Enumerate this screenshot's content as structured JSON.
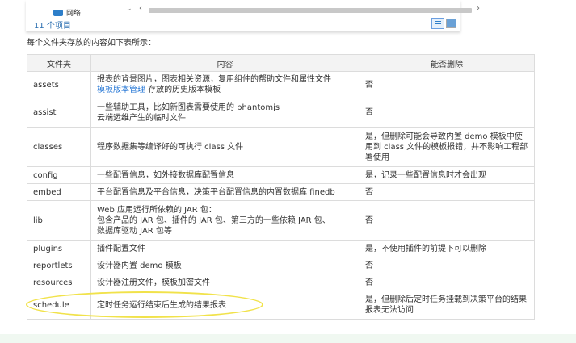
{
  "explorer": {
    "nav_item": "网络",
    "item_count": "11 个项目",
    "chevron": "⌄",
    "scroll_left": "‹",
    "scroll_right": "›"
  },
  "intro": "每个文件夹存放的内容如下表所示：",
  "table": {
    "headers": [
      "文件夹",
      "内容",
      "能否删除"
    ],
    "rows": [
      {
        "folder": "assets",
        "content_line1": "报表的背景图片，图表相关资源，复用组件的帮助文件和属性文件",
        "content_link": "模板版本管理",
        "content_line2_rest": " 存放的历史版本模板",
        "deletable": "否"
      },
      {
        "folder": "assist",
        "content_line1": "一些辅助工具，比如新图表需要使用的 phantomjs",
        "content_line2": "云端运维产生的临时文件",
        "deletable": "否"
      },
      {
        "folder": "classes",
        "content": "程序数据集等编译好的可执行 class 文件",
        "deletable": "是，但删除可能会导致内置 demo 模板中使用到 class 文件的模板报错，并不影响工程部署使用"
      },
      {
        "folder": "config",
        "content": "一些配置信息，如外接数据库配置信息",
        "deletable": "是，记录一些配置信息时才会出现"
      },
      {
        "folder": "embed",
        "content": "平台配置信息及平台信息，决策平台配置信息的内置数据库 finedb",
        "deletable": "否"
      },
      {
        "folder": "lib",
        "content_line1": "Web 应用运行所依赖的 JAR 包：",
        "content_line2": "包含产品的 JAR 包、插件的 JAR 包、第三方的一些依赖 JAR 包、",
        "content_line3": "数据库驱动 JAR 包等",
        "deletable": "否"
      },
      {
        "folder": "plugins",
        "content": "插件配置文件",
        "deletable": "是，不使用插件的前提下可以删除"
      },
      {
        "folder": "reportlets",
        "content": "设计器内置 demo 模板",
        "deletable": "否"
      },
      {
        "folder": "resources",
        "content": "设计器注册文件，模板加密文件",
        "deletable": "否"
      },
      {
        "folder": "schedule",
        "content": "定时任务运行结束后生成的结果报表",
        "deletable": "是，但删除后定时任务挂载到决策平台的结果报表无法访问"
      }
    ]
  },
  "colors": {
    "link": "#2878d6",
    "highlight": "#f1e24a",
    "header_bg": "#f3f3f3"
  }
}
